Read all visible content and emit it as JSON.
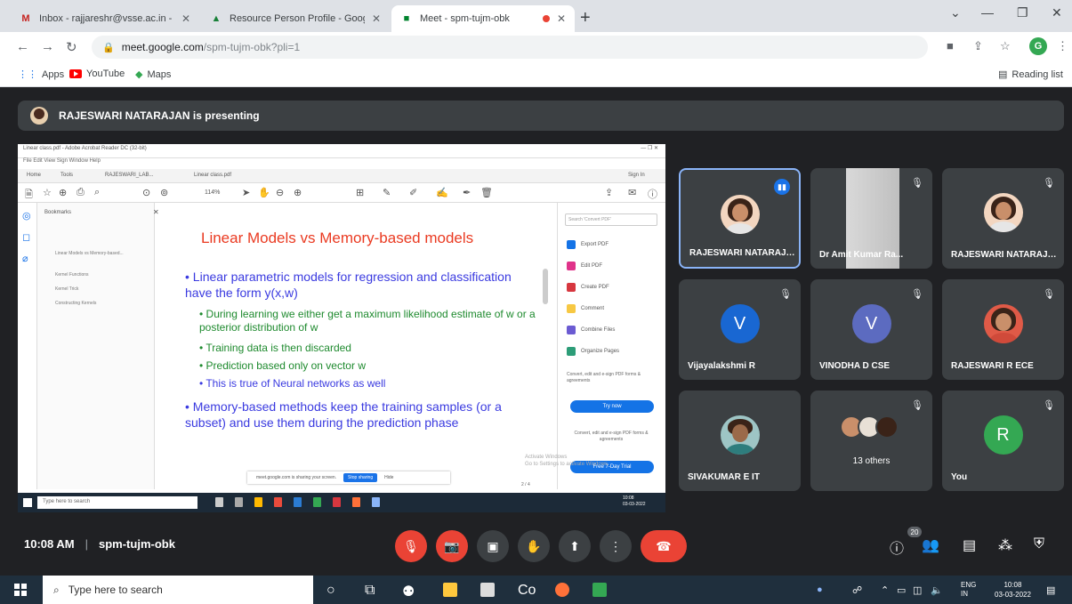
{
  "browser": {
    "tabs": [
      {
        "title": "Inbox - rajjareshr@vsse.ac.in - ",
        "icon": "gmail-icon",
        "color": "#c5221f"
      },
      {
        "title": "Resource Person Profile - Googl",
        "icon": "drive-icon",
        "color": "#188038"
      },
      {
        "title": "Meet - spm-tujm-obk",
        "icon": "meet-icon",
        "color": "#00832d"
      }
    ],
    "url_host": "meet.google.com",
    "url_path": "/spm-tujm-obk?pli=1",
    "profile_letter": "G",
    "bookmarks": [
      {
        "label": "Apps"
      },
      {
        "label": "YouTube"
      },
      {
        "label": "Maps"
      }
    ],
    "reading_list": "Reading list"
  },
  "meet": {
    "presenting_banner": "RAJESWARI NATARAJAN is presenting",
    "meeting_time": "10:08 AM",
    "meeting_code": "spm-tujm-obk",
    "participant_badge": "20",
    "participants": [
      {
        "name": "RAJESWARI NATARAJAN",
        "kind": "photo",
        "speaking": true
      },
      {
        "name": "Dr Amit Kumar Ra...",
        "kind": "camera"
      },
      {
        "name": "RAJESWARI NATARAJAN",
        "kind": "photo"
      },
      {
        "name": "Vijayalakshmi R",
        "kind": "letter",
        "letter": "V",
        "color": "#1967d2"
      },
      {
        "name": "VINODHA D CSE",
        "kind": "letter",
        "letter": "V",
        "color": "#5c6bc0"
      },
      {
        "name": "RAJESWARI R ECE",
        "kind": "photo"
      },
      {
        "name": "SIVAKUMAR E IT",
        "kind": "photo"
      },
      {
        "name": "13 others",
        "kind": "others"
      },
      {
        "name": "You",
        "kind": "letter",
        "letter": "R",
        "color": "#34a853"
      }
    ]
  },
  "shared_screen": {
    "app_title": "Linear class.pdf - Adobe Acrobat Reader DC (32-bit)",
    "menu": "File  Edit  View  Sign  Window  Help",
    "tabs": [
      "Home",
      "Tools",
      "RAJESWARI_LAB...",
      "Linear class.pdf"
    ],
    "zoom": "114%",
    "sign_in": "Sign In",
    "bookmarks_heading": "Bookmarks",
    "bookmark_items": [
      "Linear Models vs Memory-based...",
      "Kernel Functions",
      "Kernel Trick",
      "Constructing Kernels"
    ],
    "search_placeholder": "Search 'Convert PDF'",
    "tools": [
      {
        "label": "Export PDF",
        "color": "#1473e6"
      },
      {
        "label": "Edit PDF",
        "color": "#e0338a"
      },
      {
        "label": "Create PDF",
        "color": "#d7373f"
      },
      {
        "label": "Comment",
        "color": "#f7c843"
      },
      {
        "label": "Combine Files",
        "color": "#6b5bd2"
      },
      {
        "label": "Organize Pages",
        "color": "#2d9d78"
      }
    ],
    "convert_note": "Convert, edit and e-sign PDF forms & agreements",
    "try_button": "Try now",
    "trial_button": "Free 7-Day Trial",
    "sharing_notice": "meet.google.com is sharing your screen.",
    "stop_sharing": "Stop sharing",
    "hide": "Hide",
    "page_indicator": "2 / 4",
    "watermark": "Activate Windows",
    "watermark_sub": "Go to Settings to activate Windows.",
    "inner_search": "Type here to search",
    "inner_time": "10:08",
    "inner_date": "03-03-2022",
    "slide": {
      "title": "Linear Models vs Memory-based models",
      "b1": "Linear parametric models for regression and classification have the form y(x,w)",
      "b1a": "During learning we either get a maximum likelihood estimate of w or a posterior distribution of w",
      "b1b": "Training data is then discarded",
      "b1c": "Prediction based only on vector w",
      "b1d": "This is true of Neural networks as well",
      "b2": "Memory-based methods keep the training samples (or a subset) and use them during the prediction phase"
    }
  },
  "controls": {
    "mic": "mic-off-icon",
    "cam": "camera-off-icon",
    "captions": "captions-icon",
    "hand": "raise-hand-icon",
    "present": "present-icon",
    "more": "more-icon",
    "end": "end-call-icon"
  },
  "taskbar": {
    "search_placeholder": "Type here to search",
    "lang_top": "ENG",
    "lang_bottom": "IN",
    "time": "10:08",
    "date": "03-03-2022"
  }
}
